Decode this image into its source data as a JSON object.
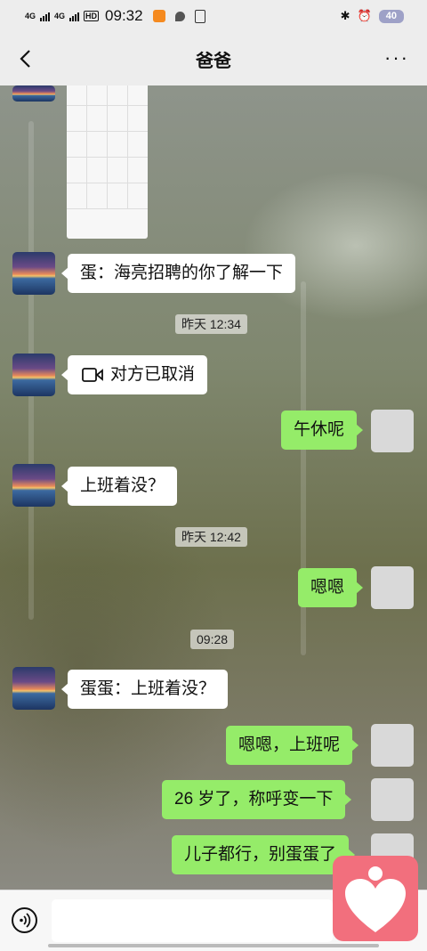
{
  "status_bar": {
    "network1": "4G",
    "network2": "4G",
    "hd": "HD",
    "time": "09:32",
    "battery": "40"
  },
  "header": {
    "title": "爸爸",
    "more": "···"
  },
  "messages": [
    {
      "kind": "image",
      "from": "dad"
    },
    {
      "kind": "text",
      "from": "dad",
      "text": "蛋：海亮招聘的你了解一下"
    },
    {
      "kind": "time",
      "text": "昨天 12:34"
    },
    {
      "kind": "call",
      "from": "dad",
      "text": "对方已取消",
      "icon": "video-call-icon"
    },
    {
      "kind": "text",
      "from": "me",
      "text": "午休呢"
    },
    {
      "kind": "text",
      "from": "dad",
      "text": "上班着没？"
    },
    {
      "kind": "time",
      "text": "昨天 12:42"
    },
    {
      "kind": "text",
      "from": "me",
      "text": "嗯嗯"
    },
    {
      "kind": "time",
      "text": "09:28"
    },
    {
      "kind": "text",
      "from": "dad",
      "text": "蛋蛋：上班着没？"
    },
    {
      "kind": "text",
      "from": "me",
      "text": "嗯嗯，上班呢"
    },
    {
      "kind": "text",
      "from": "me",
      "text": "26 岁了，称呼变一下"
    },
    {
      "kind": "text",
      "from": "me",
      "text": "儿子都行，别蛋蛋了"
    }
  ],
  "colors": {
    "my_bubble": "#95ec69",
    "their_bubble": "#ffffff",
    "float_button": "#f26f7d"
  },
  "input": {
    "value": "",
    "voice_icon": "voice-input-icon"
  },
  "floating_button": {
    "icon": "heart-person-icon"
  }
}
